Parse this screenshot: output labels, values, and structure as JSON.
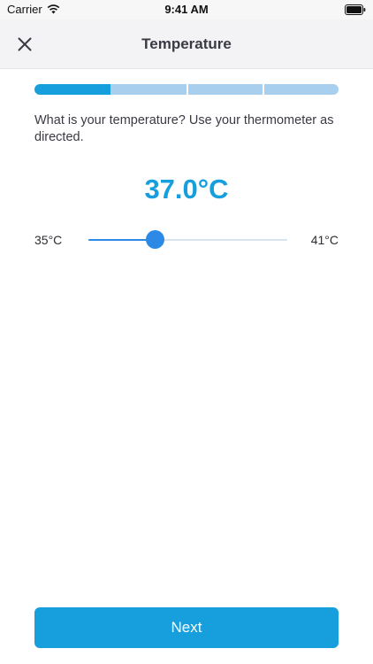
{
  "status_bar": {
    "carrier": "Carrier",
    "time": "9:41 AM",
    "icons": [
      "wifi-icon",
      "battery-icon"
    ]
  },
  "nav": {
    "title": "Temperature",
    "close_icon": "close-icon"
  },
  "progress": {
    "steps_total": 4,
    "steps_completed": 1,
    "fill_color": "#169fdc",
    "track_color": "#a8cfee"
  },
  "question": "What is your temperature? Use your thermometer as directed.",
  "temperature": {
    "display": "37.0°C",
    "value": 37.0,
    "min": 35,
    "max": 41,
    "min_label": "35°C",
    "max_label": "41°C",
    "accent_color": "#169fdc",
    "slider_color": "#2c8ae6"
  },
  "footer": {
    "next_label": "Next"
  }
}
